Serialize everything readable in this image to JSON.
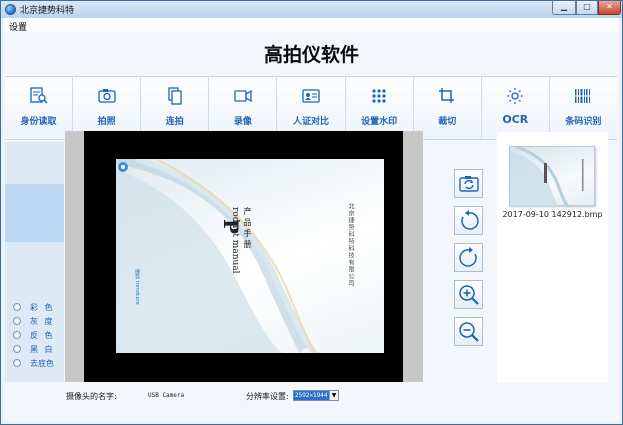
{
  "window": {
    "title": "北京捷势科特",
    "buttons": {
      "minimize": "▁",
      "maximize": "□",
      "close": "✕"
    }
  },
  "menu": {
    "settings": "设置"
  },
  "app_title": "高拍仪软件",
  "toolbar": [
    {
      "label": "身份读取",
      "icon": "id-card-search-icon"
    },
    {
      "label": "拍照",
      "icon": "camera-icon"
    },
    {
      "label": "连拍",
      "icon": "copy-icon"
    },
    {
      "label": "录像",
      "icon": "video-camera-icon"
    },
    {
      "label": "人证对比",
      "icon": "person-card-icon"
    },
    {
      "label": "设置水印",
      "icon": "grid-dots-icon"
    },
    {
      "label": "裁切",
      "icon": "crop-icon"
    },
    {
      "label": "OCR",
      "icon": "sun-icon"
    },
    {
      "label": "条码识别",
      "icon": "barcode-icon"
    }
  ],
  "color_modes": [
    "彩 色",
    "灰 度",
    "反 色",
    "黑 白",
    "去底色"
  ],
  "preview": {
    "doc_title_big": "P",
    "doc_title_cn": "产品手册",
    "doc_title_en": "roduct manual",
    "doc_company": "北京捷势科特科技有限公司",
    "doc_logo_text": "捷势 trendcore"
  },
  "side_tools": [
    "rotate-refresh-icon",
    "rotate-left-icon",
    "rotate-right-icon",
    "zoom-in-icon",
    "zoom-out-icon"
  ],
  "thumbnails": [
    {
      "filename": "2017-09-10 142912.bmp"
    }
  ],
  "status": {
    "camera_label": "摄像头的名字:",
    "camera_name": "USB Camera",
    "resolution_label": "分辨率设置:",
    "resolution_value": "2592×1944",
    "dropdown_arrow": "▼"
  },
  "colors": {
    "accent_text": "#1e63b8",
    "selection": "#bcd8f3"
  }
}
